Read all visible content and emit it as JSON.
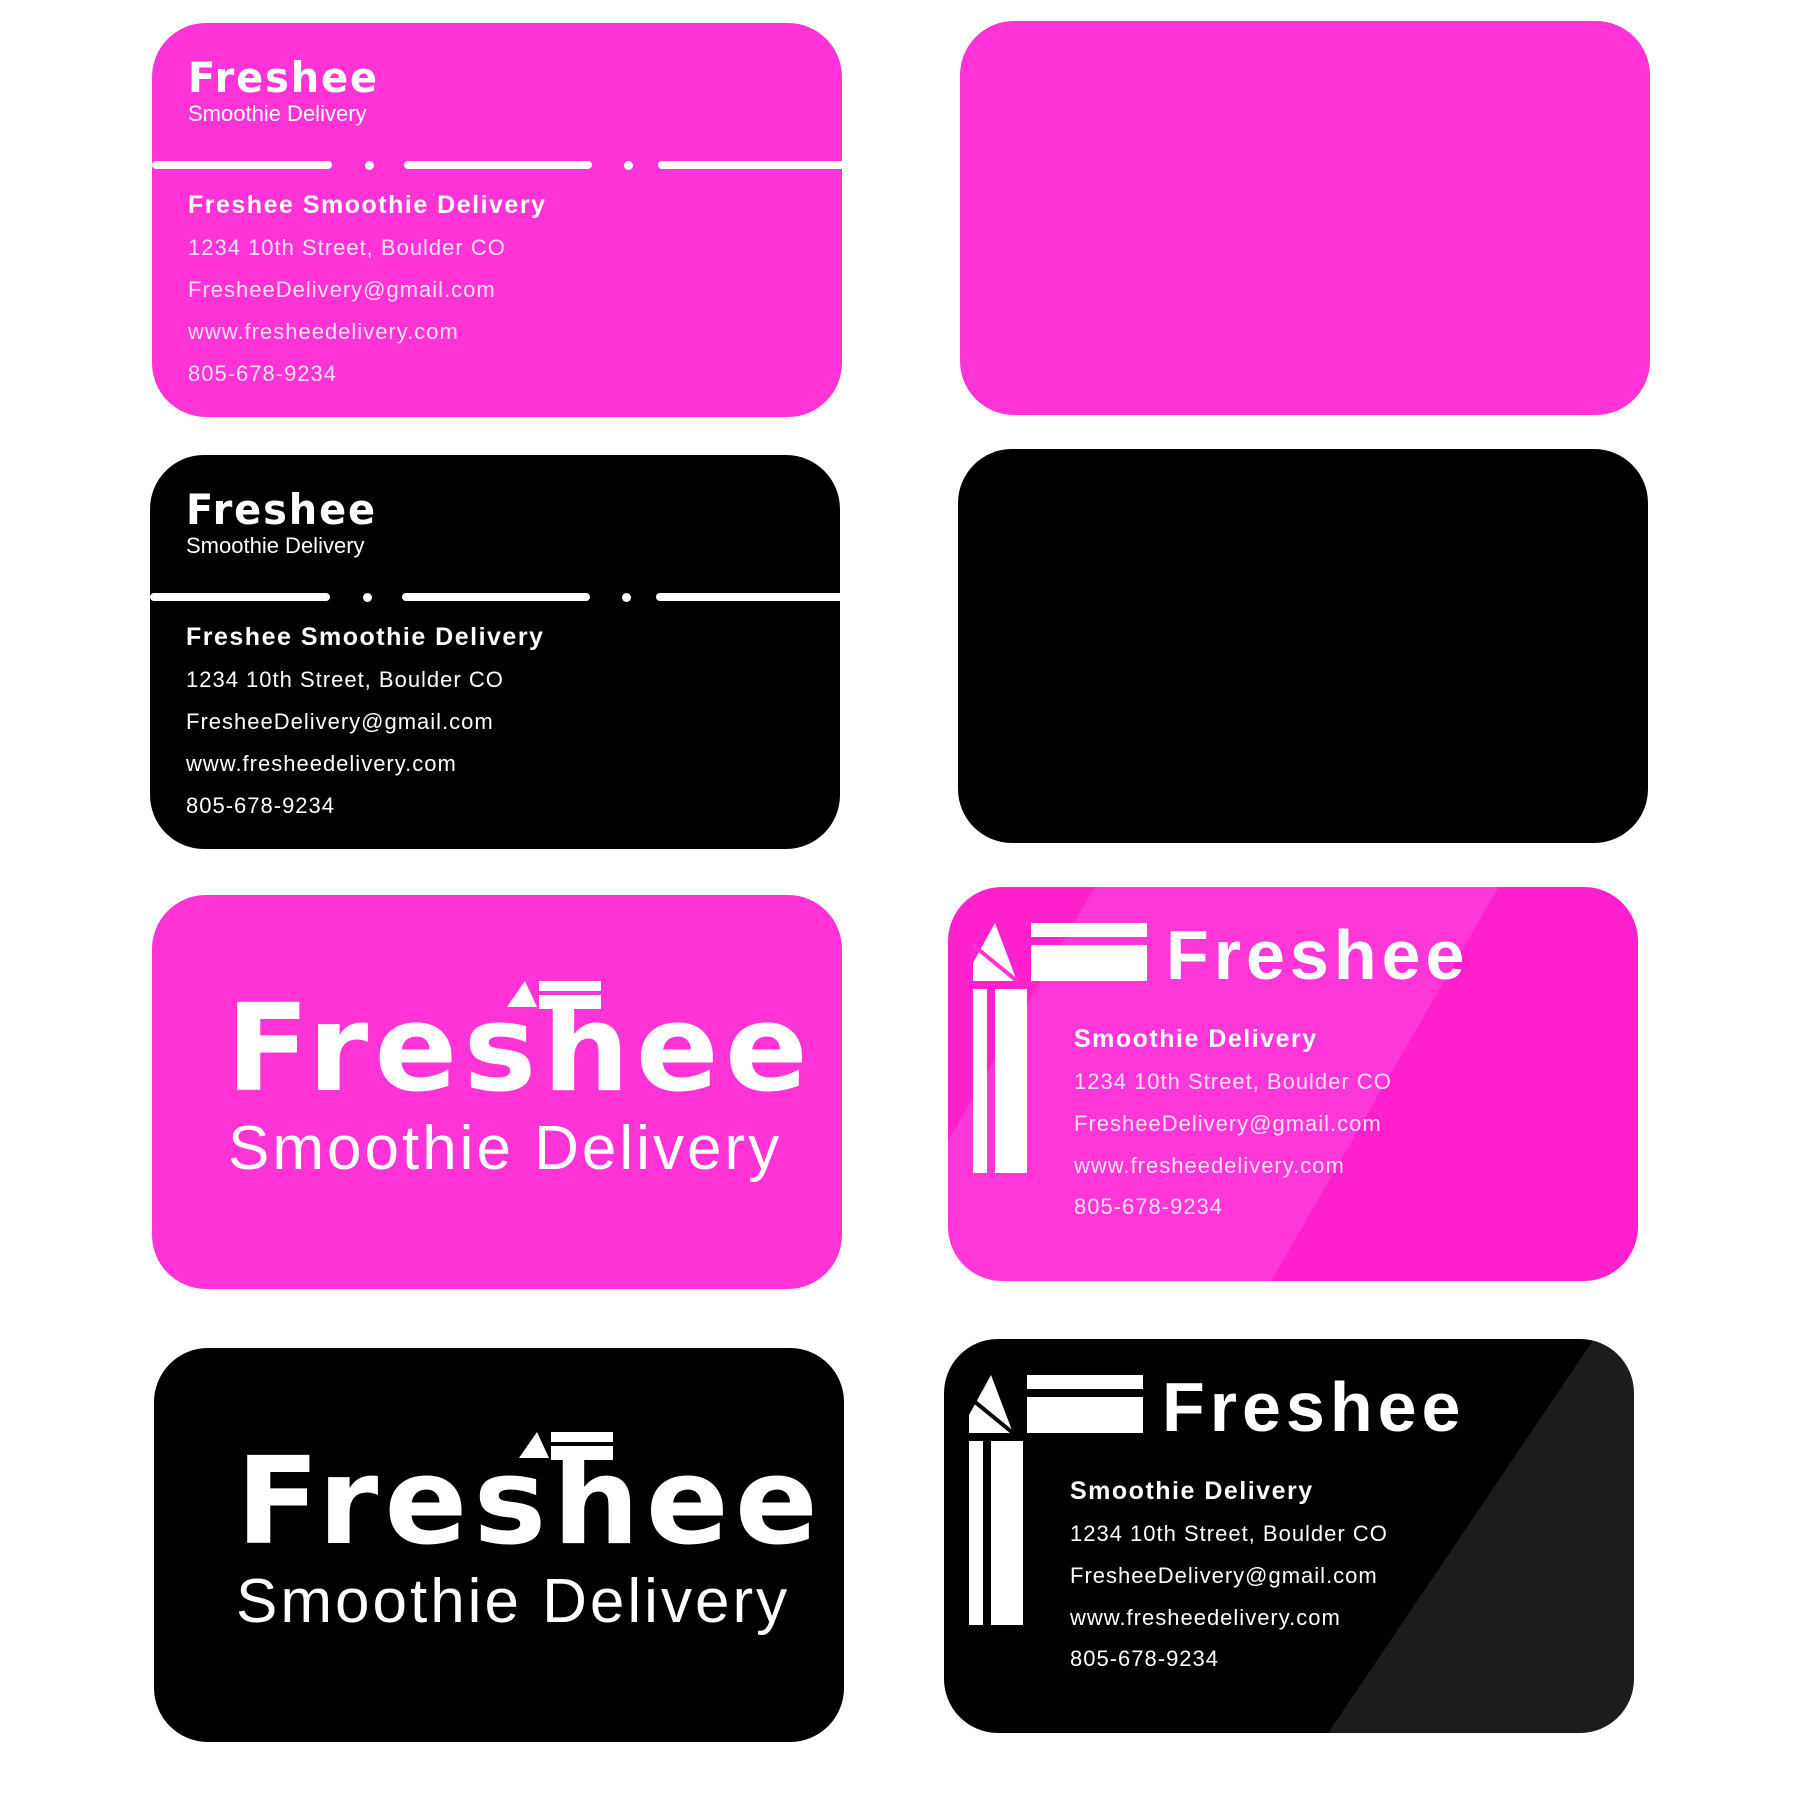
{
  "brand": {
    "logo": "Freshee",
    "tagline": "Smoothie Delivery",
    "company_name": "Freshee Smoothie Delivery",
    "address": "1234 10th Street, Boulder CO",
    "email": "FresheeDelivery@gmail.com",
    "website": "www.fresheedelivery.com",
    "phone": "805-678-9234"
  },
  "colors": {
    "pink": "#ff33d6",
    "pink_dark": "#ff1fcc",
    "black": "#000000",
    "dark_gray": "#1c1c1c",
    "white": "#ffffff"
  },
  "icons": {
    "logo_mark": "straw-smoothie-icon"
  }
}
